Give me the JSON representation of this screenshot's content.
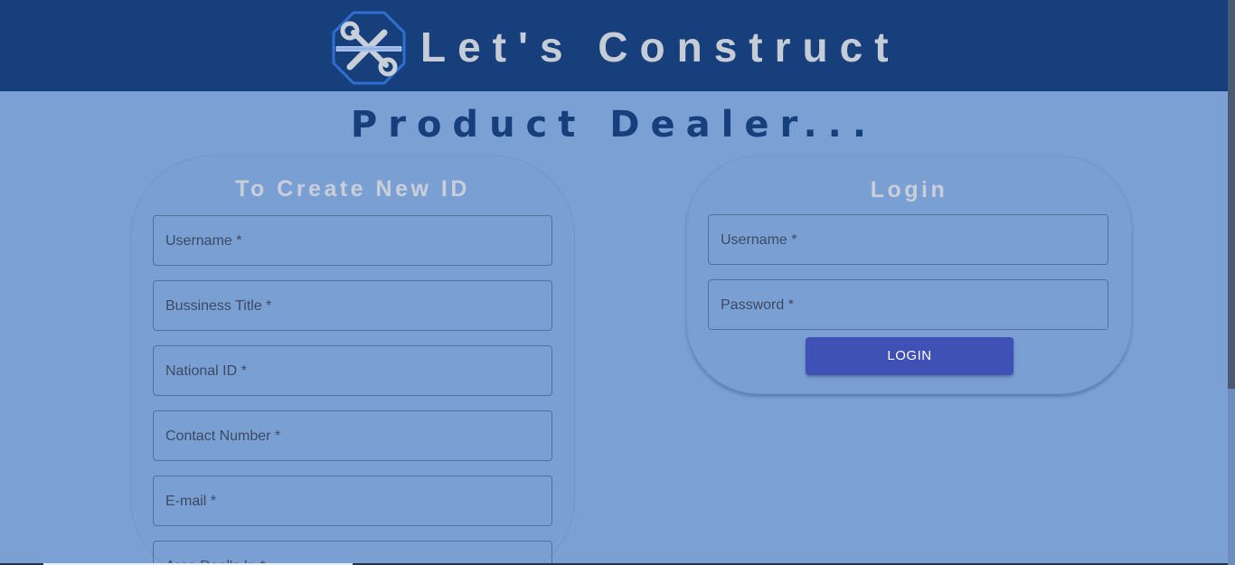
{
  "header": {
    "title": "Let's Construct",
    "logo_icon": "wrench-screwdriver-octagon-logo",
    "colors": {
      "header_bg": "#163f7b",
      "title_text": "#c6ccd6"
    }
  },
  "page": {
    "subtitle": "Product Dealer...",
    "colors": {
      "page_bg": "#7aa0d4",
      "subtitle_text": "#163f7b"
    }
  },
  "create_form": {
    "title": "To Create New ID",
    "fields": [
      {
        "label": "Username *"
      },
      {
        "label": "Bussiness Title *"
      },
      {
        "label": "National ID *"
      },
      {
        "label": "Contact Number *"
      },
      {
        "label": "E-mail *"
      },
      {
        "label": "Area Deal's In *"
      }
    ]
  },
  "login_form": {
    "title": "Login",
    "fields": [
      {
        "label": "Username *"
      },
      {
        "label": "Password *"
      }
    ],
    "button_label": "LOGIN",
    "colors": {
      "button_bg": "#3f51b5",
      "button_text": "#ffffff"
    }
  }
}
